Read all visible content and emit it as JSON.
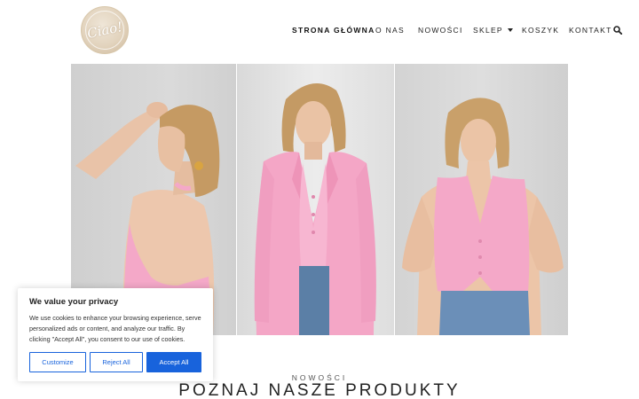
{
  "logo": {
    "text": "Ciao!"
  },
  "nav": {
    "items": [
      {
        "label": "STRONA GŁÓWNA",
        "active": true
      },
      {
        "label": "O NAS"
      },
      {
        "label": "NOWOŚCI"
      },
      {
        "label": "SKLEP"
      },
      {
        "label": "KOSZYK"
      },
      {
        "label": "KONTAKT"
      }
    ],
    "search_icon": "search-icon"
  },
  "section": {
    "subtitle": "NOWOŚCI",
    "title": "POZNAJ NASZE PRODUKTY"
  },
  "cookie": {
    "title": "We value your privacy",
    "body": "We use cookies to enhance your browsing experience, serve personalized ads or content, and analyze our traffic. By clicking \"Accept All\", you consent to our use of cookies.",
    "customize": "Customize",
    "reject": "Reject All",
    "accept": "Accept All"
  },
  "colors": {
    "accent": "#1863dc",
    "outfit": "#f4a8c8",
    "denim": "#5b7fa6"
  }
}
